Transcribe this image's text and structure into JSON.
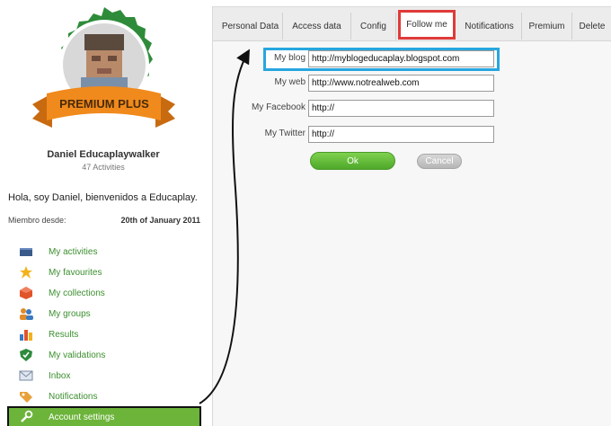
{
  "profile": {
    "badge_text": "PREMIUM PLUS",
    "name": "Daniel Educaplaywalker",
    "activities": "47 Activities",
    "greeting": "Hola, soy Daniel, bienvenidos a Educaplay.",
    "member_label": "Miembro desde:",
    "member_date": "20th of January 2011"
  },
  "menu": {
    "items": [
      {
        "label": "My activities",
        "icon": "activities-icon"
      },
      {
        "label": "My favourites",
        "icon": "star-icon"
      },
      {
        "label": "My collections",
        "icon": "collections-icon"
      },
      {
        "label": "My groups",
        "icon": "groups-icon"
      },
      {
        "label": "Results",
        "icon": "results-chart-icon"
      },
      {
        "label": "My validations",
        "icon": "shield-check-icon"
      },
      {
        "label": "Inbox",
        "icon": "envelope-icon"
      },
      {
        "label": "Notifications",
        "icon": "tag-icon"
      },
      {
        "label": "Account settings",
        "icon": "wrench-icon"
      }
    ],
    "active_index": 8
  },
  "tabs": [
    {
      "label": "Personal Data"
    },
    {
      "label": "Access data"
    },
    {
      "label": "Config"
    },
    {
      "label": "Follow me"
    },
    {
      "label": "Notifications"
    },
    {
      "label": "Premium"
    },
    {
      "label": "Delete"
    }
  ],
  "active_tab": "Follow me",
  "form": {
    "blog_label": "My blog",
    "blog_value": "http://myblogeducaplay.blogspot.com",
    "web_label": "My web",
    "web_value": "http://www.notrealweb.com",
    "facebook_label": "My Facebook",
    "facebook_value": "http://",
    "twitter_label": "My Twitter",
    "twitter_value": "http://",
    "ok_label": "Ok",
    "cancel_label": "Cancel"
  },
  "colors": {
    "accent_green": "#6cb43a",
    "link_green": "#3b8f2e",
    "tab_highlight": "#e03a3a",
    "field_highlight": "#27a6e0",
    "badge_green": "#2e8b3a",
    "ribbon_orange": "#f08a1c"
  }
}
